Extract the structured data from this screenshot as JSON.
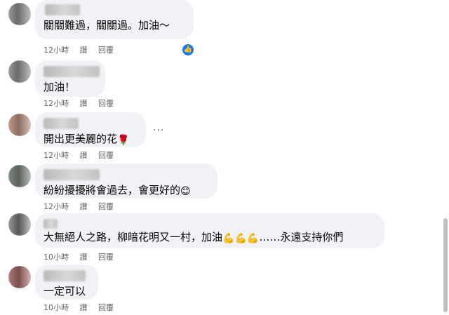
{
  "comments": [
    {
      "text": "關關難過，關關過。加油～",
      "time": "12小時",
      "like": "讚",
      "reply": "回覆",
      "has_reaction": true
    },
    {
      "text": "加油！",
      "time": "12小時",
      "like": "讚",
      "reply": "回覆"
    },
    {
      "text": "開出更美麗的花",
      "emoji": "🌹",
      "time": "12小時",
      "like": "讚",
      "reply": "回覆"
    },
    {
      "text": "紛紛擾擾將會過去，會更好的",
      "emoji": "😊",
      "time": "12小時",
      "like": "讚",
      "reply": "回覆"
    },
    {
      "text": "大無絕人之路，柳暗花明又一村，加油",
      "emoji": "💪💪💪",
      "text_after": "……永遠支持你們",
      "time": "10小時",
      "like": "讚",
      "reply": "回覆"
    },
    {
      "text": "一定可以",
      "time": "10小時",
      "like": "讚",
      "reply": "回覆"
    }
  ],
  "icons": {
    "reaction": "like-thumb-icon",
    "more": "more-options-icon"
  },
  "colors": {
    "bubble": "#f0f2f5",
    "meta": "#65676b",
    "like_blue": "#1877f2"
  }
}
